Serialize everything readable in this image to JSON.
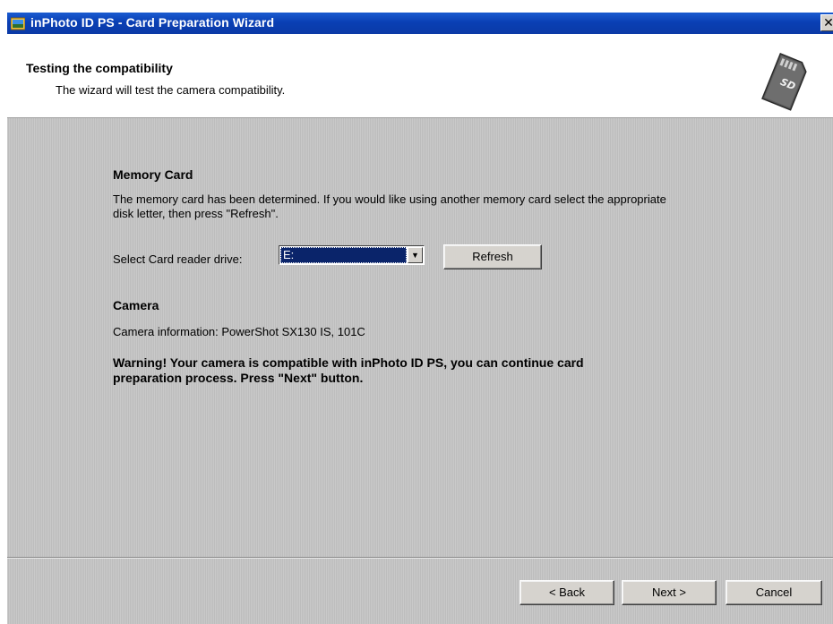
{
  "window": {
    "title": "inPhoto ID PS - Card Preparation Wizard",
    "close_label": "✕"
  },
  "header": {
    "title": "Testing the compatibility",
    "subtitle": "The wizard will test the camera compatibility.",
    "icon": "sd-card-icon"
  },
  "memory_card": {
    "heading": "Memory Card",
    "description_line1": "The memory card has been determined. If you would like using another memory card select the appropriate",
    "description_line2": "disk letter, then press \"Refresh\".",
    "drive_label": "Select Card reader drive:",
    "drive_value": "E:",
    "refresh_label": "Refresh"
  },
  "camera": {
    "heading": "Camera",
    "info": "Camera information: PowerShot SX130 IS, 101C",
    "warning_line1": "Warning! Your camera is compatible with inPhoto ID PS, you can continue card",
    "warning_line2": "preparation process. Press \"Next\" button."
  },
  "buttons": {
    "back": "< Back",
    "next": "Next >",
    "cancel": "Cancel"
  },
  "colors": {
    "titlebar": "#0a3fb4",
    "selection": "#0a246a",
    "dialog_bg": "#c4c4c4"
  }
}
